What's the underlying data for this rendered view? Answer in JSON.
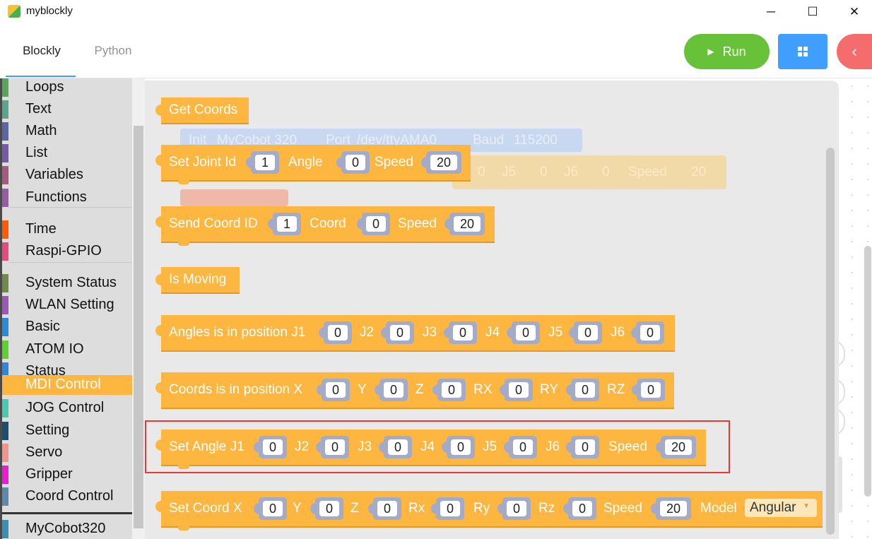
{
  "window": {
    "title": "myblockly",
    "minimize_glyph": "─",
    "maximize_glyph": "☐",
    "close_glyph": "✕"
  },
  "nav": {
    "tabs": [
      {
        "label": "Blockly",
        "active": true
      },
      {
        "label": "Python",
        "active": false
      }
    ],
    "run_label": "Run",
    "run_icon": "play-icon",
    "grid_icon": "grid-icon",
    "back_icon": "chevron-left-icon",
    "back_glyph": "‹",
    "run_glyph": "▶"
  },
  "colors": {
    "run": "#67c23a",
    "grid": "#409eff",
    "back": "#f56c6c",
    "block": "#fdb640",
    "selected_category": "#fdb640",
    "highlight": "#e53935"
  },
  "toolbox": {
    "categories": [
      {
        "label": "Loops",
        "color": "#5ba55b"
      },
      {
        "label": "Text",
        "color": "#5ba58c"
      },
      {
        "label": "Math",
        "color": "#5b67a5"
      },
      {
        "label": "List",
        "color": "#745ba5"
      },
      {
        "label": "Variables",
        "color": "#a55b80"
      },
      {
        "label": "Functions",
        "color": "#995ba5"
      },
      {
        "label": "Time",
        "color": "#ff5a00"
      },
      {
        "label": "Raspi-GPIO",
        "color": "#e8497e"
      },
      {
        "label": "System Status",
        "color": "#6f8a4a"
      },
      {
        "label": "WLAN Setting",
        "color": "#9b59b6"
      },
      {
        "label": "Basic",
        "color": "#2a8bd8"
      },
      {
        "label": "ATOM IO",
        "color": "#5fd02d"
      },
      {
        "label": "Status",
        "color": "#2e86de"
      },
      {
        "label": "MDI Control",
        "color": "#fdb640",
        "selected": true
      },
      {
        "label": "JOG Control",
        "color": "#48c9b0"
      },
      {
        "label": "Setting",
        "color": "#1b4f72"
      },
      {
        "label": "Servo",
        "color": "#f1948a"
      },
      {
        "label": "Gripper",
        "color": "#e91ecf"
      },
      {
        "label": "Coord Control",
        "color": "#5d8aa8"
      },
      {
        "label": "MyCobot320",
        "color": "#3a8fb7"
      }
    ]
  },
  "ghost_blocks": {
    "init_block": {
      "init": "Init",
      "model": "MyCobot 320",
      "port_label": "Port",
      "port": "/dev/ttyAMA0",
      "baud_label": "Baud",
      "baud": "115200"
    },
    "angle_block": {
      "j5": "J5",
      "j6": "J6",
      "speed": "Speed",
      "v0": "0",
      "v20": "20"
    }
  },
  "blocks": {
    "get_coords": {
      "label": "Get Coords"
    },
    "set_joint_id": {
      "label": "Set Joint Id",
      "id": "1",
      "angle_label": "Angle",
      "angle": "0",
      "speed_label": "Speed",
      "speed": "20"
    },
    "send_coord_id": {
      "label": "Send Coord ID",
      "id": "1",
      "coord_label": "Coord",
      "coord": "0",
      "speed_label": "Speed",
      "speed": "20"
    },
    "is_moving": {
      "label": "Is Moving"
    },
    "angles_in_position": {
      "label": "Angles is in position J1",
      "j1": "0",
      "l2": "J2",
      "j2": "0",
      "l3": "J3",
      "j3": "0",
      "l4": "J4",
      "j4": "0",
      "l5": "J5",
      "j5": "0",
      "l6": "J6",
      "j6": "0"
    },
    "coords_in_position": {
      "label": "Coords is in position X",
      "x": "0",
      "ly": "Y",
      "y": "0",
      "lz": "Z",
      "z": "0",
      "lrx": "RX",
      "rx": "0",
      "lry": "RY",
      "ry": "0",
      "lrz": "RZ",
      "rz": "0"
    },
    "set_angle": {
      "label": "Set Angle J1",
      "j1": "0",
      "l2": "J2",
      "j2": "0",
      "l3": "J3",
      "j3": "0",
      "l4": "J4",
      "j4": "0",
      "l5": "J5",
      "j5": "0",
      "l6": "J6",
      "j6": "0",
      "speed_label": "Speed",
      "speed": "20"
    },
    "set_coord": {
      "label": "Set Coord X",
      "x": "0",
      "ly": "Y",
      "y": "0",
      "lz": "Z",
      "z": "0",
      "lrx": "Rx",
      "rx": "0",
      "lry": "Ry",
      "ry": "0",
      "lrz": "Rz",
      "rz": "0",
      "speed_label": "Speed",
      "speed": "20",
      "model_label": "Model",
      "model": "Angular"
    }
  }
}
